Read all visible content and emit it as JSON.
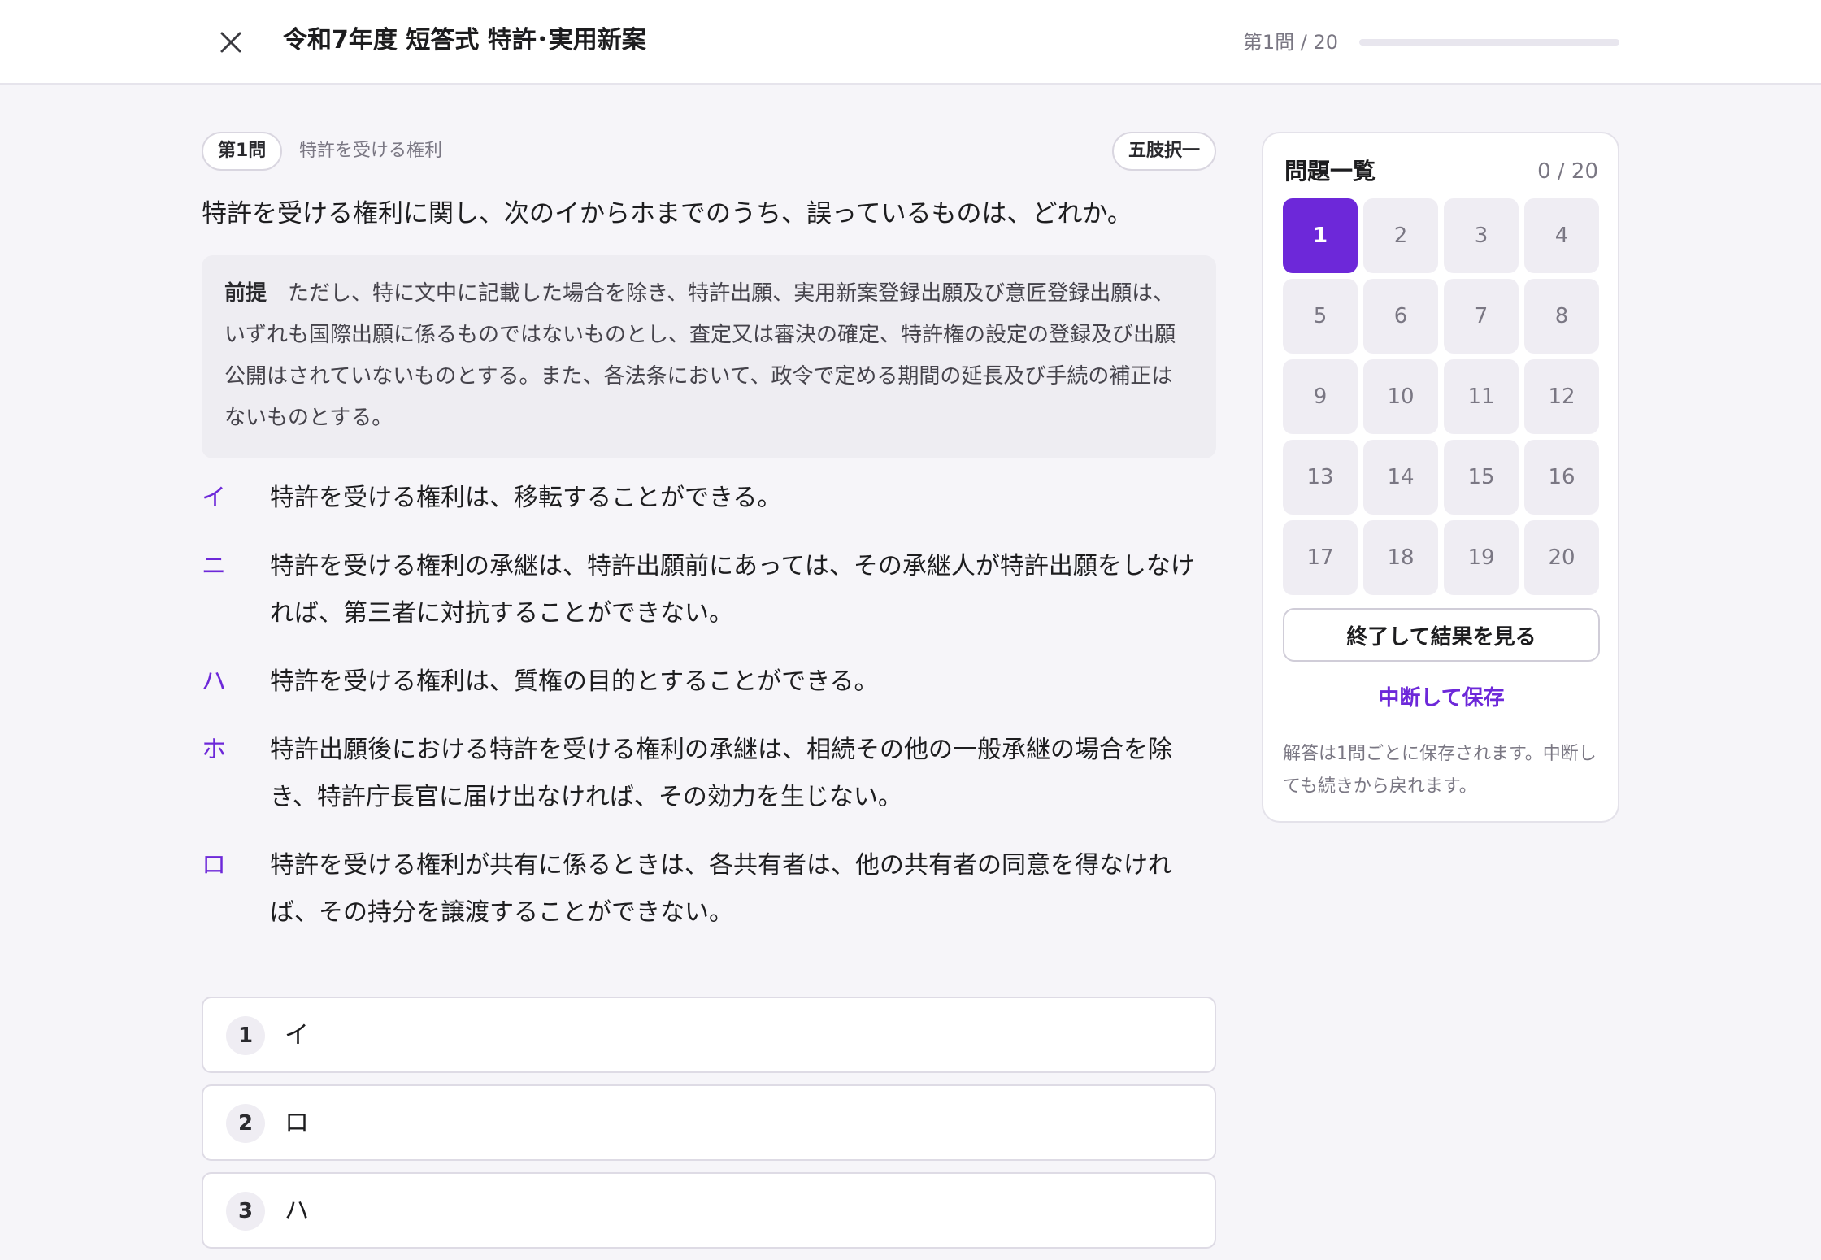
{
  "header": {
    "title": "令和7年度 短答式 特許･実用新案",
    "progress_label": "第1問 / 20",
    "progress_fraction": 0.0
  },
  "question": {
    "number_badge": "第1問",
    "category": "特許を受ける権利",
    "format_badge": "五肢択一",
    "text": "特許を受ける権利に関し、次のイからホまでのうち、誤っているものは、どれか。",
    "premise_label": "前提",
    "premise_text": "ただし、特に文中に記載した場合を除き、特許出願、実用新案登録出願及び意匠登録出願は、いずれも国際出願に係るものではないものとし、査定又は審決の確定、特許権の設定の登録及び出願公開はされていないものとする。また、各法条において、政令で定める期間の延長及び手続の補正はないものとする。",
    "statements": [
      {
        "letter": "イ",
        "text": "特許を受ける権利は、移転することができる。"
      },
      {
        "letter": "ニ",
        "text": "特許を受ける権利の承継は、特許出願前にあっては、その承継人が特許出願をしなければ、第三者に対抗することができない。"
      },
      {
        "letter": "ハ",
        "text": "特許を受ける権利は、質権の目的とすることができる。"
      },
      {
        "letter": "ホ",
        "text": "特許出願後における特許を受ける権利の承継は、相続その他の一般承継の場合を除き、特許庁長官に届け出なければ、その効力を生じない。"
      },
      {
        "letter": "ロ",
        "text": "特許を受ける権利が共有に係るときは、各共有者は、他の共有者の同意を得なければ、その持分を譲渡することができない。"
      }
    ]
  },
  "choices": [
    {
      "num": "1",
      "label": "イ"
    },
    {
      "num": "2",
      "label": "ロ"
    },
    {
      "num": "3",
      "label": "ハ"
    }
  ],
  "panel": {
    "title": "問題一覧",
    "count": "0 / 20",
    "active_question": 1,
    "questions": [
      "1",
      "2",
      "3",
      "4",
      "5",
      "6",
      "7",
      "8",
      "9",
      "10",
      "11",
      "12",
      "13",
      "14",
      "15",
      "16",
      "17",
      "18",
      "19",
      "20"
    ],
    "finish_label": "終了して結果を見る",
    "suspend_label": "中断して保存",
    "note": "解答は1問ごとに保存されます。中断しても続きから戻れます。"
  },
  "colors": {
    "accent": "#6d28d9",
    "background": "#f6f5f9",
    "premise_bg": "#eeedf2"
  },
  "icons": {
    "close": "close-icon"
  }
}
